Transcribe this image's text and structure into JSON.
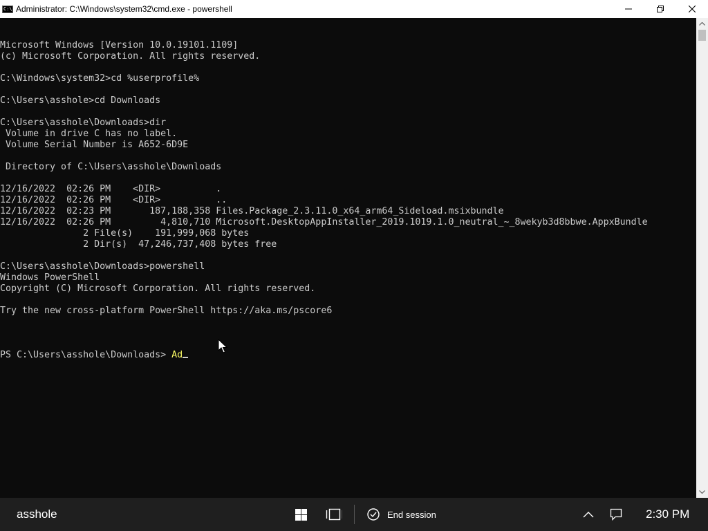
{
  "window": {
    "title": "Administrator: C:\\Windows\\system32\\cmd.exe - powershell",
    "icon": "cmd-icon",
    "icon_glyph": "C:\\"
  },
  "console": {
    "lines": [
      "Microsoft Windows [Version 10.0.19101.1109]",
      "(c) Microsoft Corporation. All rights reserved.",
      "",
      "C:\\Windows\\system32>cd %userprofile%",
      "",
      "C:\\Users\\asshole>cd Downloads",
      "",
      "C:\\Users\\asshole\\Downloads>dir",
      " Volume in drive C has no label.",
      " Volume Serial Number is A652-6D9E",
      "",
      " Directory of C:\\Users\\asshole\\Downloads",
      "",
      "12/16/2022  02:26 PM    <DIR>          .",
      "12/16/2022  02:26 PM    <DIR>          ..",
      "12/16/2022  02:23 PM       187,188,358 Files.Package_2.3.11.0_x64_arm64_Sideload.msixbundle",
      "12/16/2022  02:26 PM         4,810,710 Microsoft.DesktopAppInstaller_2019.1019.1.0_neutral_~_8wekyb3d8bbwe.AppxBundle",
      "               2 File(s)    191,999,068 bytes",
      "               2 Dir(s)  47,246,737,408 bytes free",
      "",
      "C:\\Users\\asshole\\Downloads>powershell",
      "Windows PowerShell",
      "Copyright (C) Microsoft Corporation. All rights reserved.",
      "",
      "Try the new cross-platform PowerShell https://aka.ms/pscore6",
      ""
    ],
    "prompt": "PS C:\\Users\\asshole\\Downloads> ",
    "typed_input": "Ad"
  },
  "taskbar": {
    "user": "asshole",
    "end_session_label": "End session",
    "clock": "2:30 PM",
    "icons": [
      "windows-start-icon",
      "task-view-icon",
      "end-session-icon",
      "chevron-up-icon",
      "notification-icon"
    ]
  },
  "colors": {
    "console_bg": "#0c0c0c",
    "console_fg": "#cccccc",
    "typed_input": "#ffff66",
    "taskbar_bg": "#1f1f1f"
  }
}
